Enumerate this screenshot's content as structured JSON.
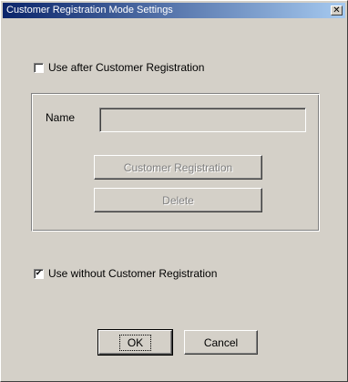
{
  "window": {
    "title": "Customer Registration Mode Settings",
    "close_symbol": "✕"
  },
  "options": {
    "use_after": {
      "label": "Use after Customer Registration",
      "checked": false
    },
    "use_without": {
      "label": "Use without Customer Registration",
      "checked": true
    }
  },
  "registration": {
    "name_label": "Name",
    "name_value": "",
    "button1_label": "Customer Registration",
    "button2_label": "Delete"
  },
  "footer": {
    "ok_label": "OK",
    "cancel_label": "Cancel"
  },
  "icons": {
    "check_glyph": "✔"
  }
}
